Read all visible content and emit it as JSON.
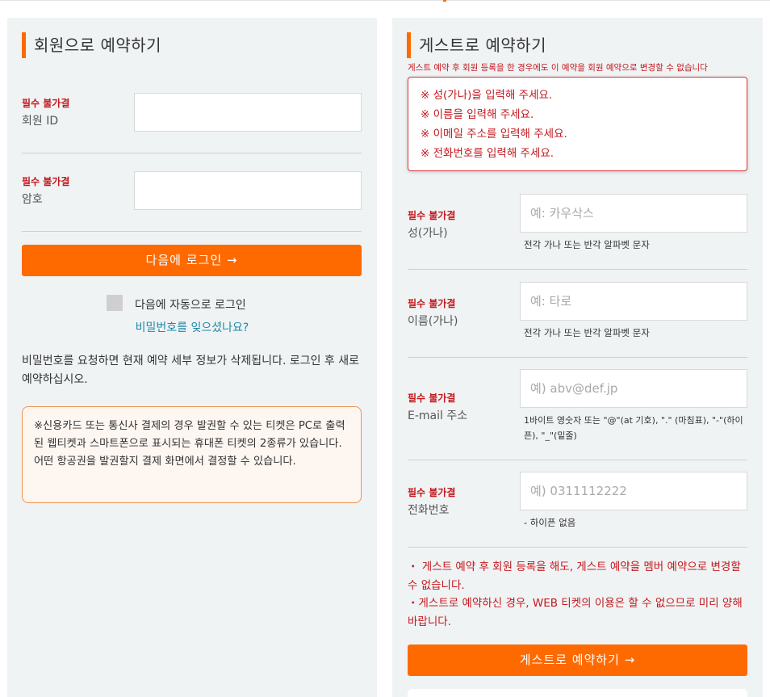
{
  "member": {
    "heading": "회원으로 예약하기",
    "required_label": "필수 불가결",
    "id_label": "회원 ID",
    "password_label": "암호",
    "login_button": "다음에 로그인 →",
    "auto_login_label": "다음에 자동으로 로그인",
    "forgot_link": "비밀번호를 잊으셨나요?",
    "info_text": "비밀번호를 요청하면 현재 예약 세부 정보가 삭제됩니다. 로그인 후 새로 예약하십시오.",
    "notice_line1": "※신용카드 또는 통신사 결제의 경우 발권할 수 있는 티켓은 PC로 출력된 웹티켓과 스마트폰으로 표시되는 휴대폰 티켓의 2종류가 있습니다.",
    "notice_line2": "어떤 항공권을 발권할지 결제 화면에서 결정할 수 있습니다."
  },
  "guest": {
    "heading": "게스트로 예약하기",
    "warning": "게스트 예약 후 회원 등록을 한 경우에도 이 예약을 회원 예약으로 변경할 수 없습니다",
    "errors": [
      "※ 성(가나)을 입력해 주세요.",
      "※ 이름을 입력해 주세요.",
      "※ 이메일 주소를 입력해 주세요.",
      "※ 전화번호를 입력해 주세요."
    ],
    "required_label": "필수 불가결",
    "surname_label": "성(가나)",
    "surname_placeholder": "예: 카우삭스",
    "surname_hint": "전각 가나 또는 반각 알파벳 문자",
    "name_label": "이름(가나)",
    "name_placeholder": "예: 타로",
    "name_hint": "전각 가나 또는 반각 알파벳 문자",
    "email_label": "E-mail 주소",
    "email_placeholder": "예) abv@def.jp",
    "email_hint": "1바이트 영숫자 또는 \"@\"(at 기호), \".\" (마침표), \"-\"(하이픈), \"_\"(밑줄)",
    "phone_label": "전화번호",
    "phone_placeholder": "예) 0311112222",
    "phone_hint": "- 하이픈 없음",
    "note1": "・ 게스트 예약 후 회원 등록을 해도, 게스트 예약을 멤버 예약으로 변경할 수 없습니다.",
    "note2": "・게스트로 예약하신 경우, WEB 티켓의 이용은 할 수 없으므로 미리 양해 바랍니다.",
    "submit_button": "게스트로 예약하기 →"
  },
  "colors": {
    "accent": "#ff6a00",
    "error": "#c4171c",
    "panel_bg": "#f0f3f4",
    "link": "#1a8aa8"
  }
}
